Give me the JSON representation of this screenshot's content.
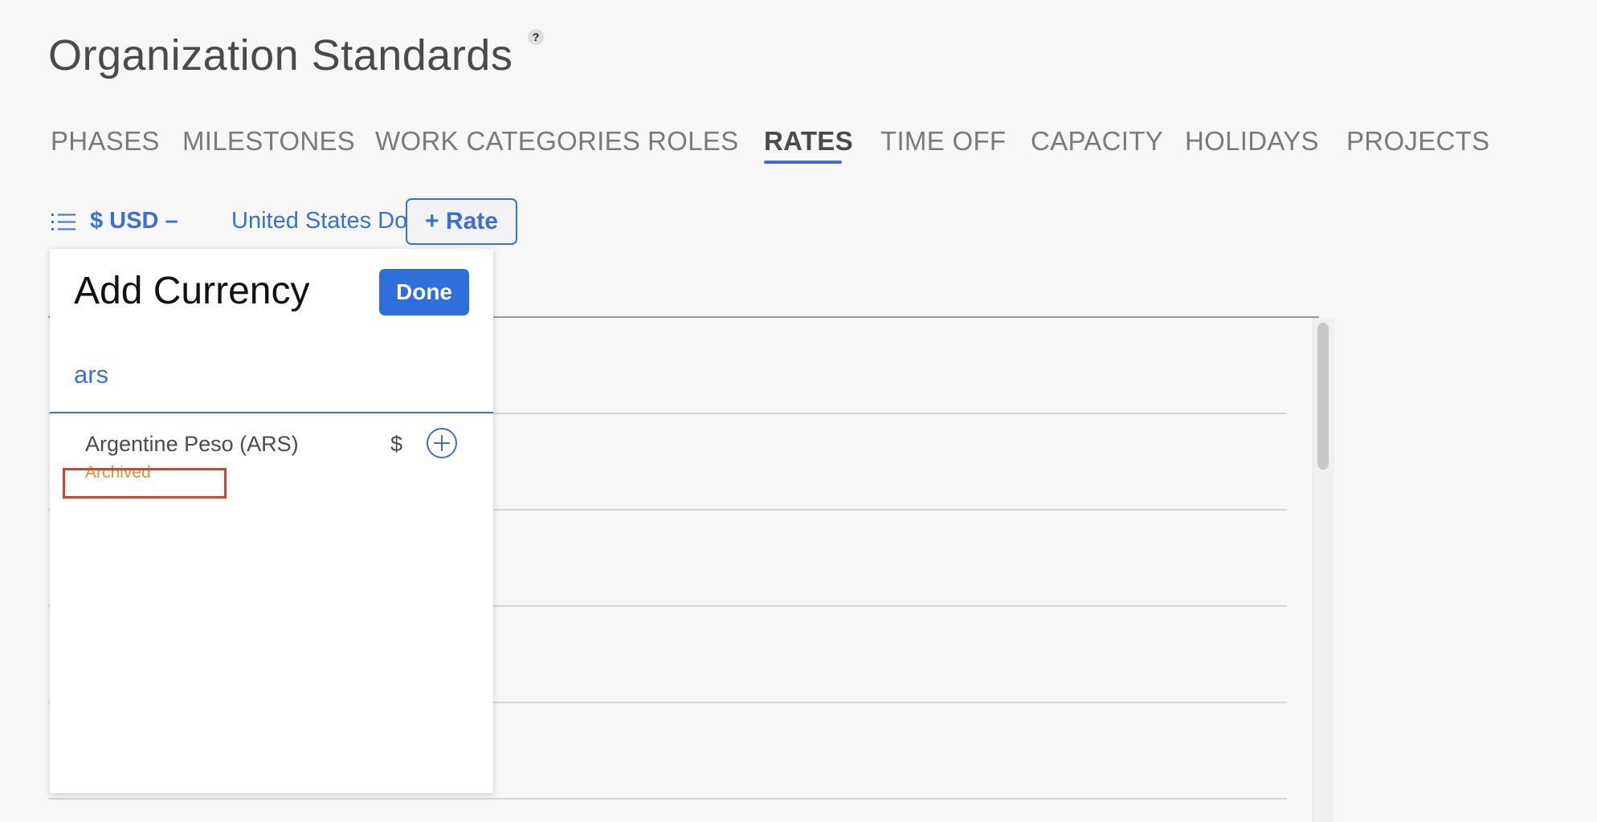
{
  "header": {
    "title": "Organization Standards",
    "help_label": "?"
  },
  "tabs": [
    {
      "label": "PHASES",
      "active": false
    },
    {
      "label": "MILESTONES",
      "active": false
    },
    {
      "label": "WORK CATEGORIES",
      "active": false
    },
    {
      "label": "ROLES",
      "active": false
    },
    {
      "label": "RATES",
      "active": true
    },
    {
      "label": "TIME OFF",
      "active": false
    },
    {
      "label": "CAPACITY",
      "active": false
    },
    {
      "label": "HOLIDAYS",
      "active": false
    },
    {
      "label": "PROJECTS",
      "active": false
    }
  ],
  "currency_selector": {
    "code": "$ USD –",
    "name": "United States Dollar",
    "icon": "list-icon"
  },
  "add_rate_button": "+ Rate",
  "add_currency_popover": {
    "title": "Add Currency",
    "done_label": "Done",
    "search_value": "ars",
    "results": [
      {
        "name": "Argentine Peso (ARS)",
        "symbol": "$",
        "status": "Archived",
        "add_icon": "plus-circle-icon"
      }
    ]
  },
  "colors": {
    "accent": "#3a6fd8",
    "done_button": "#2f6fdb",
    "archived": "#e88a3a",
    "highlight": "#d9412e",
    "background": "#f7f7f7"
  }
}
